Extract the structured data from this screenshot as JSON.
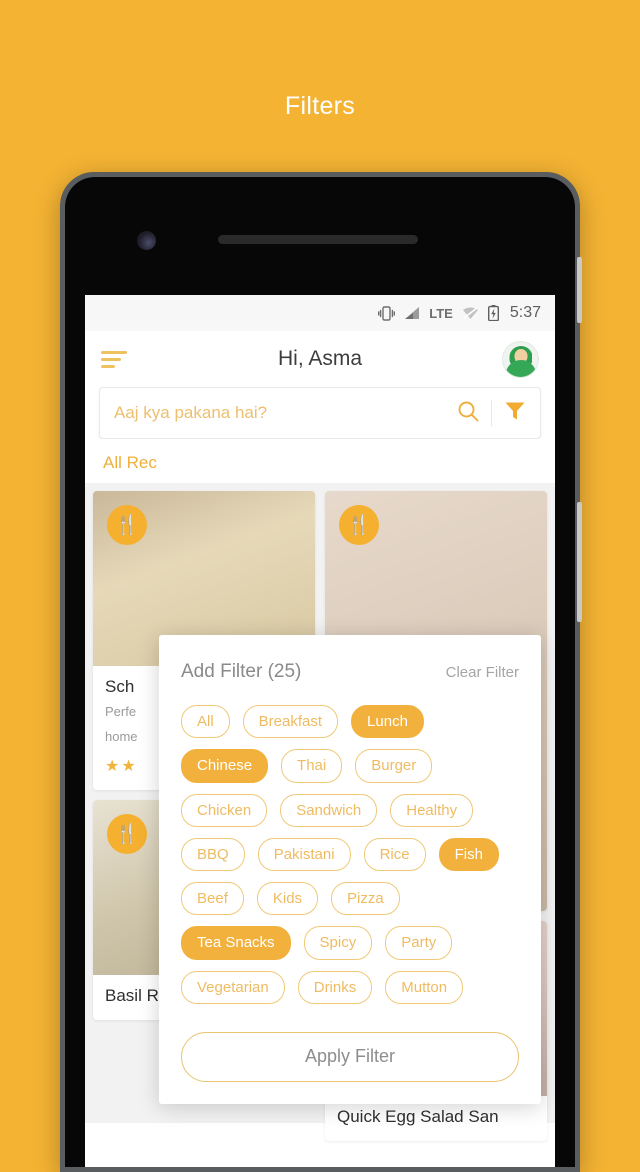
{
  "page": {
    "heading": "Filters",
    "background_color": "#f4b333"
  },
  "status_bar": {
    "icons": [
      "vibrate-icon",
      "signal-icon",
      "lte-label",
      "wifi-off-icon",
      "battery-charging-icon"
    ],
    "network": "LTE",
    "time": "5:37"
  },
  "app_header": {
    "menu_icon": "hamburger-icon",
    "title": "Hi, Asma",
    "avatar": "user-avatar"
  },
  "search": {
    "placeholder": "Aaj kya pakana hai?",
    "value": "",
    "search_icon": "search-icon",
    "filter_icon": "funnel-icon"
  },
  "tabs": {
    "active": "All Rec"
  },
  "filter_panel": {
    "title": "Add Filter (25)",
    "clear_label": "Clear Filter",
    "apply_label": "Apply Filter",
    "accent_color": "#f2b13c",
    "outline_color": "#f0c978",
    "chips": [
      {
        "label": "All",
        "selected": false
      },
      {
        "label": "Breakfast",
        "selected": false
      },
      {
        "label": "Lunch",
        "selected": true
      },
      {
        "label": "Chinese",
        "selected": true
      },
      {
        "label": "Thai",
        "selected": false
      },
      {
        "label": "Burger",
        "selected": false
      },
      {
        "label": "Chicken",
        "selected": false
      },
      {
        "label": "Sandwich",
        "selected": false
      },
      {
        "label": "Healthy",
        "selected": false
      },
      {
        "label": "BBQ",
        "selected": false
      },
      {
        "label": "Pakistani",
        "selected": false
      },
      {
        "label": "Rice",
        "selected": false
      },
      {
        "label": "Fish",
        "selected": true
      },
      {
        "label": "Beef",
        "selected": false
      },
      {
        "label": "Kids",
        "selected": false
      },
      {
        "label": "Pizza",
        "selected": false
      },
      {
        "label": "Tea Snacks",
        "selected": true
      },
      {
        "label": "Spicy",
        "selected": false
      },
      {
        "label": "Party",
        "selected": false
      },
      {
        "label": "Vegetarian",
        "selected": false
      },
      {
        "label": "Drinks",
        "selected": false
      },
      {
        "label": "Mutton",
        "selected": false
      }
    ]
  },
  "feed": {
    "left_column": [
      {
        "title": "Sch",
        "desc_line1": "Perfe",
        "desc_line2": "home",
        "stars": "★★",
        "badge": "cutlery-icon"
      },
      {
        "title": "Basil Roti For Weight Loss",
        "desc_line1": "",
        "desc_line2": "",
        "stars": "",
        "badge": "cutlery-icon"
      }
    ],
    "right_column": [
      {
        "title": "",
        "desc_line1": "",
        "desc_line2": "",
        "stars": "",
        "badge": "cutlery-icon"
      },
      {
        "title": "Quick Egg Salad San",
        "desc_line1": "",
        "desc_line2": "",
        "stars": "",
        "badge": "cutlery-icon"
      }
    ]
  }
}
